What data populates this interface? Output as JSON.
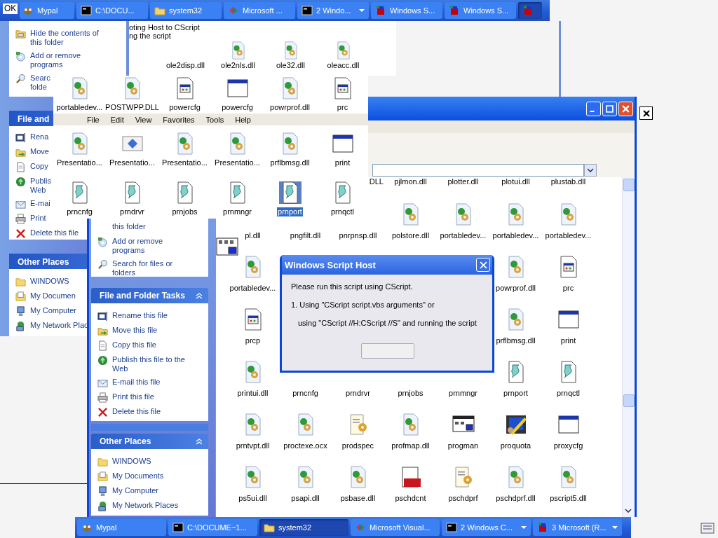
{
  "top_taskbar": {
    "overlay_text": "OK",
    "items": [
      {
        "label": "Mypal",
        "kind": "app",
        "selected": false,
        "menu": false
      },
      {
        "label": "C:\\DOCU...",
        "kind": "console",
        "selected": false,
        "menu": false
      },
      {
        "label": "system32",
        "kind": "folder",
        "selected": false,
        "menu": false
      },
      {
        "label": "Microsoft ...",
        "kind": "logo",
        "selected": false,
        "menu": false
      },
      {
        "label": "2 Windo...",
        "kind": "console",
        "selected": false,
        "menu": true
      },
      {
        "label": "Windows S...",
        "kind": "script",
        "selected": false,
        "menu": false
      },
      {
        "label": "Windows S...",
        "kind": "script",
        "selected": false,
        "menu": false
      },
      {
        "kind": "script",
        "selected": true,
        "menu": false
      }
    ]
  },
  "back_window": {
    "tasks": [
      {
        "kind": "hide",
        "lines": [
          "Hide the contents of",
          "this folder"
        ]
      },
      {
        "kind": "addremove",
        "lines": [
          "Add or remove",
          "programs"
        ]
      },
      {
        "kind": "search",
        "lines": [
          "Searc",
          "folde"
        ]
      }
    ],
    "file_tasks_title": "File and",
    "file_tasks": [
      {
        "kind": "rename",
        "lines": [
          "Rena"
        ]
      },
      {
        "kind": "move",
        "lines": [
          "Move"
        ]
      },
      {
        "kind": "copy",
        "lines": [
          "Copy"
        ]
      },
      {
        "kind": "publish",
        "lines": [
          "Publis",
          "Web"
        ]
      },
      {
        "kind": "email",
        "lines": [
          "E-mai"
        ]
      },
      {
        "kind": "print",
        "lines": [
          "Print"
        ]
      },
      {
        "kind": "delete",
        "lines": [
          "Delete this file"
        ]
      }
    ],
    "other_places_title": "Other Places",
    "other_places": [
      {
        "kind": "folder",
        "lines": [
          "WINDOWS"
        ]
      },
      {
        "kind": "documents",
        "lines": [
          "My Documen"
        ]
      },
      {
        "kind": "computer",
        "lines": [
          "My Computer"
        ]
      },
      {
        "kind": "network",
        "lines": [
          "My Network Plac"
        ]
      }
    ]
  },
  "fragment_window": {
    "lines": [
      "oting Host to CScript",
      "ng the script"
    ],
    "files": [
      {
        "label": "ole2disp.dll"
      },
      {
        "label": "ole2nls.dll",
        "kind": "dll"
      },
      {
        "label": "ole32.dll",
        "kind": "dll"
      },
      {
        "label": "oleacc.dll",
        "kind": "dll"
      }
    ]
  },
  "overlay_window": {
    "top_row": [
      {
        "label": "portabledev...",
        "kind": "dll",
        "selected": false
      },
      {
        "label": "POSTWPP.DLL",
        "kind": "dll",
        "selected": false
      },
      {
        "label": "powercfg",
        "kind": "sysfile",
        "selected": false
      },
      {
        "label": "powercfg",
        "kind": "window",
        "selected": false
      },
      {
        "label": "powrprof.dll",
        "kind": "dll",
        "selected": false
      },
      {
        "label": "prc",
        "kind": "sysfile",
        "selected": false
      }
    ],
    "menu": [
      "File",
      "Edit",
      "View",
      "Favorites",
      "Tools",
      "Help"
    ],
    "rows": [
      [
        {
          "label": "Presentatio...",
          "kind": "dll",
          "selected": false
        },
        {
          "label": "Presentatio...",
          "kind": "component",
          "selected": false
        },
        {
          "label": "Presentatio...",
          "kind": "dll",
          "selected": false
        },
        {
          "label": "Presentatio...",
          "kind": "dll",
          "selected": false
        },
        {
          "label": "prflbmsg.dll",
          "kind": "dll",
          "selected": false
        },
        {
          "label": "print",
          "kind": "window",
          "selected": false
        }
      ],
      [
        {
          "label": "prncnfg",
          "kind": "script",
          "selected": false
        },
        {
          "label": "prndrvr",
          "kind": "script",
          "selected": false
        },
        {
          "label": "prnjobs",
          "kind": "script",
          "selected": false
        },
        {
          "label": "prnmngr",
          "kind": "script",
          "selected": false
        },
        {
          "label": "prnport",
          "kind": "script",
          "selected": true
        },
        {
          "label": "prnqctl",
          "kind": "script",
          "selected": false
        }
      ]
    ]
  },
  "main_window": {
    "tasks": [
      {
        "kind": "none",
        "lines": [
          "this folder"
        ]
      },
      {
        "kind": "addremove",
        "lines": [
          "Add or remove",
          "programs"
        ]
      },
      {
        "kind": "search",
        "lines": [
          "Search for files or",
          "folders"
        ]
      }
    ],
    "file_tasks_title": "File and Folder Tasks",
    "file_tasks": [
      {
        "kind": "rename",
        "lines": [
          "Rename this file"
        ]
      },
      {
        "kind": "move",
        "lines": [
          "Move this file"
        ]
      },
      {
        "kind": "copy",
        "lines": [
          "Copy this file"
        ]
      },
      {
        "kind": "publish",
        "lines": [
          "Publish this file to the",
          "Web"
        ]
      },
      {
        "kind": "email",
        "lines": [
          "E-mail this file"
        ]
      },
      {
        "kind": "print",
        "lines": [
          "Print this file"
        ]
      },
      {
        "kind": "delete",
        "lines": [
          "Delete this file"
        ]
      }
    ],
    "other_places_title": "Other Places",
    "other_places": [
      {
        "kind": "folder",
        "lines": [
          "WINDOWS"
        ]
      },
      {
        "kind": "documents",
        "lines": [
          "My Documents"
        ]
      },
      {
        "kind": "computer",
        "lines": [
          "My Computer"
        ]
      },
      {
        "kind": "network",
        "lines": [
          "My Network Places"
        ]
      }
    ],
    "rows": [
      {
        "right": [
          {
            "label": "DLL",
            "cut": true,
            "selected": false
          },
          {
            "label": "pjlmon.dll",
            "selected": false
          },
          {
            "label": "plotter.dll",
            "selected": false
          },
          {
            "label": "plotui.dll",
            "selected": false
          },
          {
            "label": "plustab.dll",
            "selected": false
          }
        ]
      },
      {
        "left": [
          {
            "label": "pl.dll",
            "selected": false
          },
          {
            "label": "pngfilt.dll",
            "selected": false
          },
          {
            "label": "pnrpnsp.dll",
            "selected": false
          },
          {
            "label": "polstore.dll",
            "kind": "dll",
            "selected": false
          },
          {
            "label": "portabledev...",
            "kind": "dll",
            "selected": false
          },
          {
            "label": "portabledev...",
            "kind": "dll",
            "selected": false
          },
          {
            "label": "portabledev...",
            "kind": "dll",
            "selected": false
          }
        ]
      },
      {
        "left": [
          {
            "label": "portabledev...",
            "kind": "dll",
            "selected": false
          }
        ],
        "right": [
          {
            "label": "powrprof.dll",
            "kind": "dll",
            "selected": false
          },
          {
            "label": "prc",
            "kind": "sysfile",
            "selected": false
          }
        ]
      },
      {
        "left": [
          {
            "label": "prcp",
            "kind": "sysfile",
            "selected": false
          }
        ],
        "right": [
          {
            "label": "prflbmsg.dll",
            "kind": "dll",
            "selected": false
          },
          {
            "label": "print",
            "kind": "window",
            "selected": false
          }
        ]
      },
      {
        "left": [
          {
            "label": "printui.dll",
            "kind": "dll",
            "selected": false
          },
          {
            "label": "prncnfg",
            "selected": false
          },
          {
            "label": "prndrvr",
            "selected": false
          },
          {
            "label": "prnjobs",
            "selected": false
          },
          {
            "label": "prnmngr",
            "selected": false
          },
          {
            "label": "prnport",
            "kind": "script",
            "selected": false
          },
          {
            "label": "prnqctl",
            "kind": "script",
            "selected": false
          }
        ]
      },
      {
        "left": [
          {
            "label": "prntvpt.dll",
            "kind": "dll",
            "selected": false
          },
          {
            "label": "proctexe.ocx",
            "kind": "dll",
            "selected": false
          },
          {
            "label": "prodspec",
            "kind": "docgear",
            "selected": false
          },
          {
            "label": "profmap.dll",
            "kind": "dll",
            "selected": false
          },
          {
            "label": "progman",
            "kind": "progman",
            "selected": false
          },
          {
            "label": "proquota",
            "kind": "proquota",
            "selected": false
          },
          {
            "label": "proxycfg",
            "kind": "window",
            "selected": false
          }
        ]
      },
      {
        "left": [
          {
            "label": "ps5ui.dll",
            "kind": "dll",
            "selected": false
          },
          {
            "label": "psapi.dll",
            "kind": "dll",
            "selected": false
          },
          {
            "label": "psbase.dll",
            "kind": "dll",
            "selected": false
          },
          {
            "label": "pschdcnt",
            "kind": "help",
            "selected": false
          },
          {
            "label": "pschdprf",
            "kind": "docgear",
            "selected": false
          },
          {
            "label": "pschdprf.dll",
            "kind": "dll",
            "selected": false
          },
          {
            "label": "pscript5.dll",
            "kind": "dll",
            "selected": false
          }
        ]
      }
    ]
  },
  "dialog": {
    "title": "Windows Script Host",
    "lines": [
      {
        "kind": "para",
        "text": "Please run this script using CScript."
      },
      {
        "kind": "list",
        "text": "1. Using \"CScript script.vbs arguments\" or"
      },
      {
        "kind": "continuation",
        "text": "using \"CScript //H:CScript //S\" and running the script"
      }
    ]
  },
  "bottom_taskbar": {
    "items": [
      {
        "label": "Mypal",
        "kind": "app",
        "selected": false,
        "menu": false
      },
      {
        "label": "C:\\DOCUME~1...",
        "kind": "console",
        "selected": false,
        "menu": false
      },
      {
        "label": "system32",
        "kind": "folder",
        "selected": true,
        "menu": false
      },
      {
        "label": "Microsoft Visual...",
        "kind": "logo",
        "selected": false,
        "menu": false
      },
      {
        "label": "2 Windows C...",
        "kind": "console",
        "selected": false,
        "menu": true
      },
      {
        "label": "3 Microsoft (R...",
        "kind": "script",
        "selected": false,
        "menu": true
      }
    ]
  }
}
